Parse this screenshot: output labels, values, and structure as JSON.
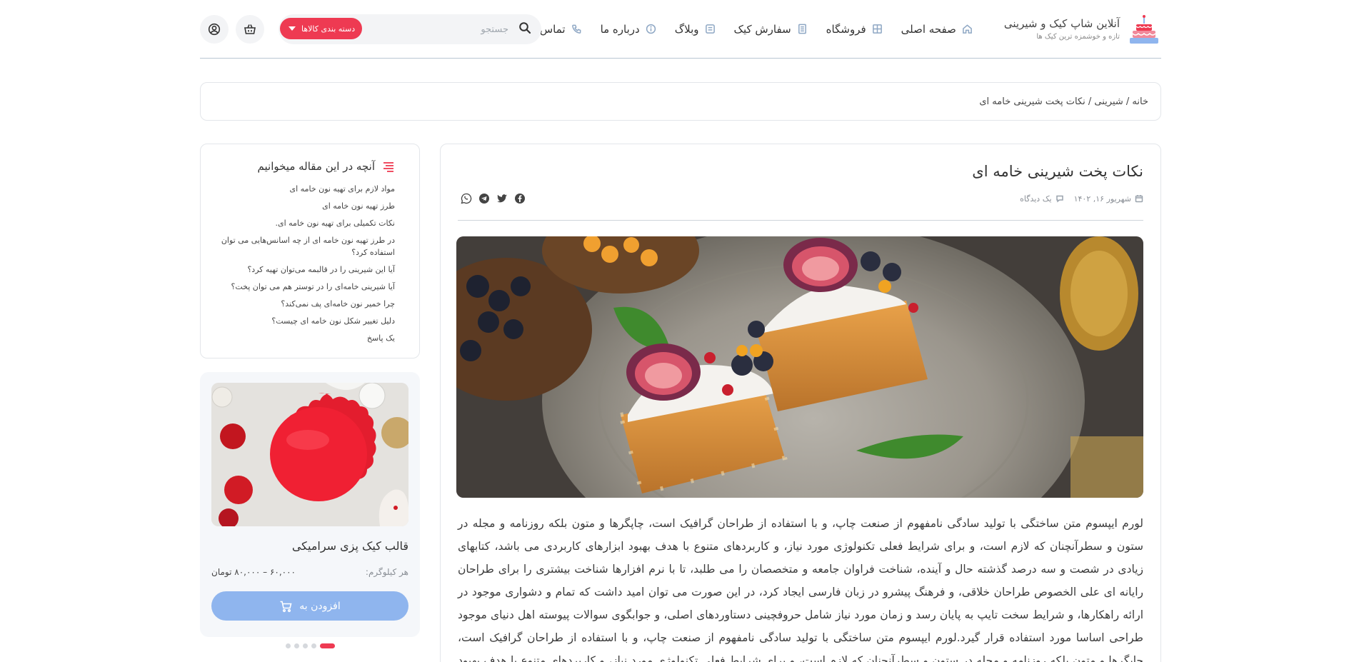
{
  "brand": {
    "title": "آنلاین شاپ کیک و شیرینی",
    "subtitle": "تازه و خوشمزه ترین کیک ها"
  },
  "nav": [
    {
      "label": "صفحه اصلی",
      "icon": "home-icon"
    },
    {
      "label": "فروشگاه",
      "icon": "store-icon"
    },
    {
      "label": "سفارش کیک",
      "icon": "order-icon"
    },
    {
      "label": "وبلاگ",
      "icon": "blog-icon"
    },
    {
      "label": "درباره ما",
      "icon": "info-icon"
    },
    {
      "label": "تماس با ما",
      "icon": "phone-icon"
    }
  ],
  "search": {
    "placeholder": "جستجو",
    "category_label": "دسته بندی کالاها"
  },
  "header_icons": [
    "basket-icon",
    "user-icon"
  ],
  "breadcrumb": "خانه / شیرینی / نکات پخت شیرینی خامه ای",
  "article": {
    "title": "نکات پخت شیرینی خامه ای",
    "date": "شهریور ۱۶, ۱۴۰۲",
    "comments": "یک دیدگاه",
    "share_icons": [
      "facebook-icon",
      "twitter-icon",
      "telegram-icon",
      "whatsapp-icon"
    ],
    "body": "لورم ایپسوم متن ساختگی با تولید سادگی نامفهوم از صنعت چاپ، و با استفاده از طراحان گرافیک است، چاپگرها و متون بلکه روزنامه و مجله در ستون و سطرآنچنان که لازم است، و برای شرایط فعلی تکنولوژی مورد نیاز، و کاربردهای متنوع با هدف بهبود ابزارهای کاربردی می باشد، کتابهای زیادی در شصت و سه درصد گذشته حال و آینده، شناخت فراوان جامعه و متخصصان را می طلبد، تا با نرم افزارها شناخت بیشتری را برای طراحان رایانه ای علی الخصوص طراحان خلاقی، و فرهنگ پیشرو در زبان فارسی ایجاد کرد، در این صورت می توان امید داشت که تمام و دشواری موجود در ارائه راهکارها، و شرایط سخت تایپ به پایان رسد و زمان مورد نیاز شامل حروفچینی دستاوردهای اصلی، و جوابگوی سوالات پیوسته اهل دنیای موجود طراحی اساسا مورد استفاده قرار گیرد.لورم ایپسوم متن ساختگی با تولید سادگی نامفهوم از صنعت چاپ، و با استفاده از طراحان گرافیک است، چاپگرها و متون بلکه روزنامه و مجله در ستون و سطرآنچنان که لازم است، و برای شرایط فعلی تکنولوژی مورد نیاز، و کاربردهای متنوع با هدف بهبود ابزارهای کاربردی می باشد، کتابهای زیادی در شصت و سه"
  },
  "toc": {
    "title": "آنچه در این مقاله میخوانیم",
    "items": [
      "مواد لازم برای تهیه نون خامه ای",
      "طرز تهیه نون خامه ای",
      "نکات تکمیلی برای تهیه نون خامه ای.",
      "در طرز تهیه نون خامه ای از چه اسانس‌هایی می توان استفاده کرد؟",
      "آیا این شیرینی را در قالبمه می‌توان تهیه کرد؟",
      "آیا شیرینی خامه‌ای را در توستر هم می توان پخت؟",
      "چرا خمیر نون خامه‌ای پف نمی‌کند؟",
      "دلیل تغییر شکل نون خامه ای چیست؟",
      "یک پاسخ"
    ]
  },
  "product": {
    "name": "قالب کیک پزی سرامیکی",
    "price_label": "هر کیلوگرم:",
    "price": "۶۰,۰۰۰ – ۸۰,۰۰۰ تومان",
    "button": "افزودن به"
  },
  "carousel": {
    "count": 5,
    "active": 0
  },
  "colors": {
    "accent": "#ee3a52",
    "button": "#8fb5ee",
    "nav_icon": "#8ea7c4"
  }
}
